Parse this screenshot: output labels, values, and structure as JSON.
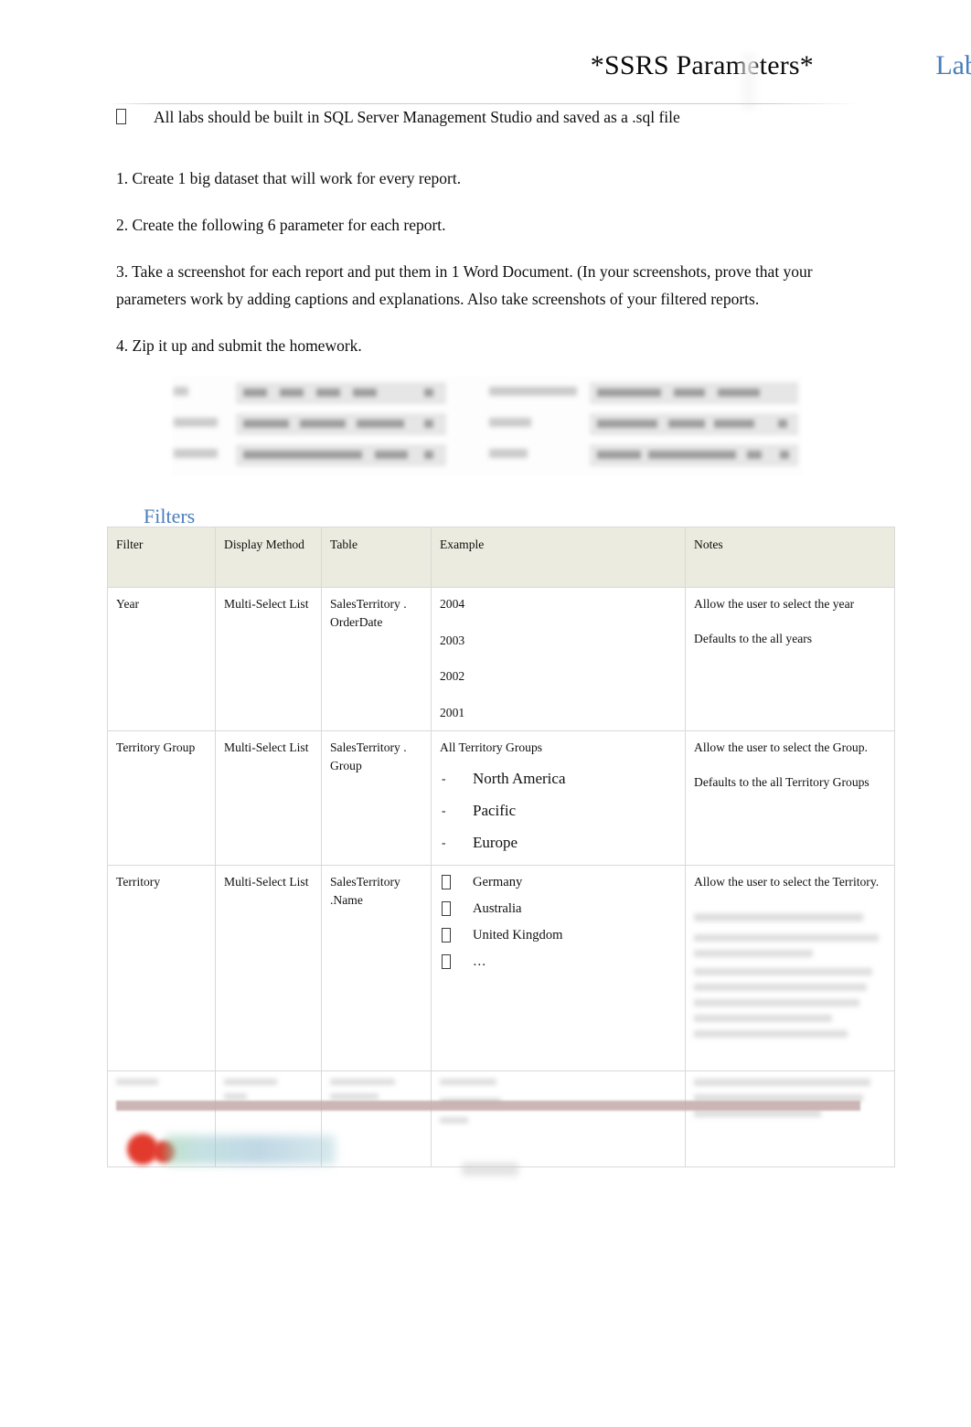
{
  "header": {
    "title": "*SSRS Parameters*",
    "subtitle": "Lab"
  },
  "lead_bullet": {
    "glyph": "missing-glyph-box",
    "text": "All labs should be built in SQL Server Management Studio and saved as a .sql file"
  },
  "instructions": [
    "1. Create 1 big dataset that will work for every report.",
    "2. Create the following 6 parameter for each report.",
    "3. Take a screenshot for each report and put them in 1 Word Document. (In your screenshots, prove that your parameters work by adding captions and explanations.   Also take screenshots of your filtered reports.",
    "4.  Zip it up and submit the homework."
  ],
  "figure": {
    "caption": "blurred screenshot of parameter form fields"
  },
  "filters_section": {
    "heading": "Filters",
    "columns": [
      "Filter",
      "Display Method",
      "Table",
      "Example",
      "Notes"
    ],
    "rows": [
      {
        "filter": "Year",
        "display_method": "Multi-Select List",
        "table": "SalesTerritory . OrderDate",
        "example_items": [
          "2004",
          "2003",
          "2002",
          "2001"
        ],
        "notes": [
          "Allow the user to select the year",
          "Defaults to the all years"
        ]
      },
      {
        "filter": "Territory Group",
        "display_method": "Multi-Select List",
        "table": "SalesTerritory . Group",
        "example_title": "All Territory Groups",
        "example_items": [
          "North America",
          "Pacific",
          "Europe"
        ],
        "notes": [
          "Allow the user to select the Group.",
          "Defaults to the all Territory Groups"
        ]
      },
      {
        "filter": "Territory",
        "display_method": "Multi-Select List",
        "table": "SalesTerritory .Name",
        "example_items": [
          "Germany",
          "Australia",
          "United Kingdom",
          "…"
        ],
        "notes": [
          "Allow the user to select the Territory."
        ]
      }
    ]
  },
  "footer": {
    "logo": "company-logo",
    "page_label": "page-number"
  }
}
